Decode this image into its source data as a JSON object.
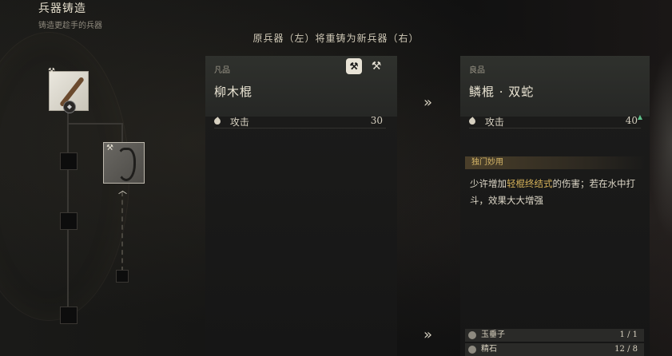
{
  "screen": {
    "title": "兵器铸造",
    "subtitle": "铸造更趁手的兵器",
    "header": "原兵器（左）将重铸为新兵器（右）"
  },
  "tree": {
    "current_weapon_icon": "willow-staff-icon",
    "next_weapon_icon": "double-snake-staff-icon"
  },
  "left_panel": {
    "grade": "凡品",
    "name": "柳木棍",
    "stat_label": "攻击",
    "stat_value": "30"
  },
  "right_panel": {
    "grade": "良品",
    "name": "鳞棍 · 双蛇",
    "stat_label": "攻击",
    "stat_value": "40",
    "stat_up": "▲",
    "skill_title": "独门妙用",
    "skill_desc_pre": "少许增加",
    "skill_desc_hl": "轻棍终结式",
    "skill_desc_post": "的伤害；若在水中打斗，效果大大增强",
    "materials": [
      {
        "name": "玉垂子",
        "count": "1 / 1"
      },
      {
        "name": "精石",
        "count": "12 / 8"
      }
    ]
  },
  "arrow_glyph": "»",
  "colors": {
    "highlight": "#d6b25a",
    "up": "#5ec08a"
  }
}
